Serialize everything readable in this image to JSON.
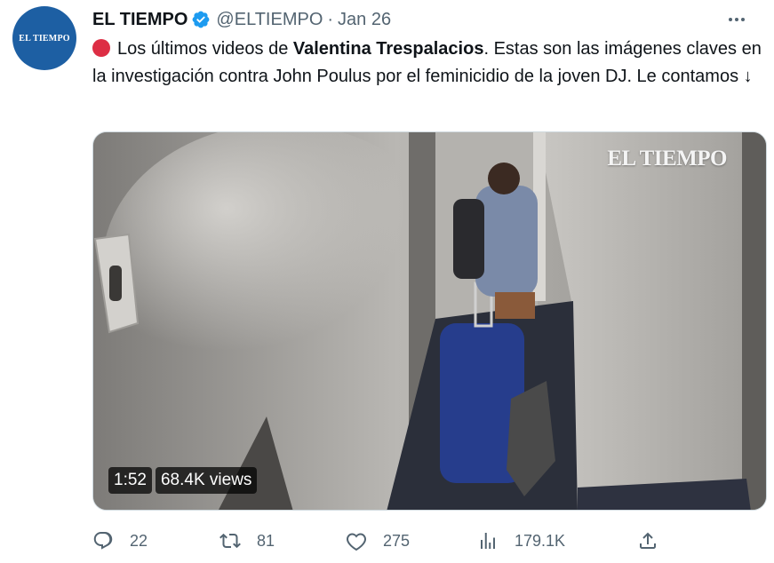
{
  "account": {
    "name": "EL TIEMPO",
    "handle": "@ELTIEMPO",
    "separator": "·",
    "date": "Jan 26",
    "avatar_text": "EL TIEMPO",
    "verified": true,
    "verified_color": "#1d9bf0",
    "avatar_color": "#1d5fa3"
  },
  "tweet": {
    "emoji": "red-circle",
    "text_part1": "Los últimos videos de ",
    "text_bold": "Valentina Trespalacios",
    "text_part2": ". Estas son las imágenes claves en la investigación contra John Poulus por el feminicidio de la joven DJ. Le contamos ↓"
  },
  "media": {
    "watermark": "EL TIEMPO",
    "duration": "1:52",
    "views_label": "68.4K views",
    "description_icon": "video-thumbnail"
  },
  "actions": {
    "replies": "22",
    "retweets": "81",
    "likes": "275",
    "views": "179.1K"
  },
  "icons": {
    "reply": "reply-icon",
    "retweet": "retweet-icon",
    "like": "heart-icon",
    "views": "views-chart-icon",
    "share": "share-icon",
    "more": "more-icon"
  }
}
